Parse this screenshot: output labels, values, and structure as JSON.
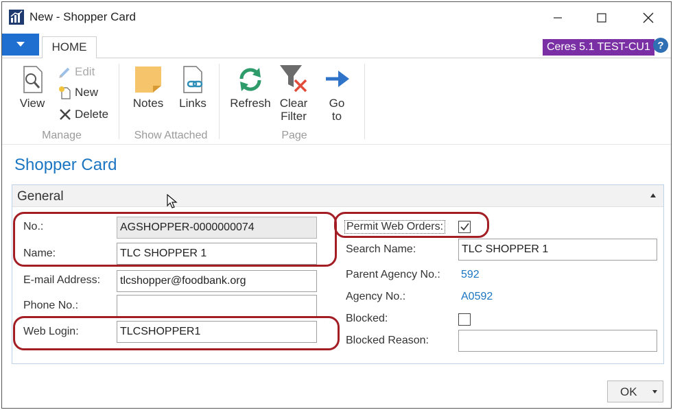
{
  "window": {
    "title": "New - Shopper Card"
  },
  "ribbon": {
    "tab_home": "HOME",
    "environment_badge": "Ceres 5.1 TEST-CU1",
    "groups": {
      "manage": {
        "label": "Manage",
        "view": "View",
        "edit": "Edit",
        "new": "New",
        "delete": "Delete"
      },
      "show_attached": {
        "label": "Show Attached",
        "notes": "Notes",
        "links": "Links"
      },
      "page": {
        "label": "Page",
        "refresh": "Refresh",
        "clear_filter_1": "Clear",
        "clear_filter_2": "Filter",
        "go_to_1": "Go",
        "go_to_2": "to"
      }
    }
  },
  "page": {
    "title": "Shopper Card",
    "fasttab": "General",
    "fields_left": {
      "no_label": "No.:",
      "no_value": "AGSHOPPER-0000000074",
      "name_label": "Name:",
      "name_value": "TLC SHOPPER 1",
      "email_label": "E-mail Address:",
      "email_value": "tlcshopper@foodbank.org",
      "phone_label": "Phone No.:",
      "phone_value": "",
      "web_login_label": "Web Login:",
      "web_login_value": "TLCSHOPPER1"
    },
    "fields_right": {
      "permit_label": "Permit Web Orders:",
      "permit_checked": true,
      "search_name_label": "Search Name:",
      "search_name_value": "TLC SHOPPER 1",
      "parent_agency_label": "Parent Agency No.:",
      "parent_agency_value": "592",
      "agency_label": "Agency No.:",
      "agency_value": "A0592",
      "blocked_label": "Blocked:",
      "blocked_checked": false,
      "blocked_reason_label": "Blocked Reason:",
      "blocked_reason_value": ""
    }
  },
  "footer": {
    "ok": "OK"
  },
  "colors": {
    "accent": "#1a75c2",
    "badge": "#7b2fa5",
    "highlight": "#a31d24",
    "file_button": "#1f6fd1"
  }
}
